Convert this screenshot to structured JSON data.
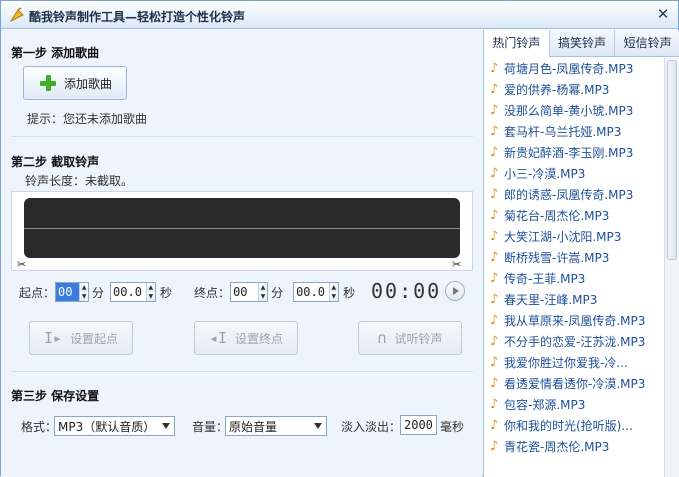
{
  "window": {
    "title": "酷我铃声制作工具—轻松打造个性化铃声",
    "close": "✕"
  },
  "step1": {
    "title": "第一步 添加歌曲",
    "add_button": "添加歌曲",
    "hint": "提示：您还未添加歌曲"
  },
  "step2": {
    "title": "第二步 截取铃声",
    "length_label": "铃声长度：未截取。",
    "start_label": "起点：",
    "end_label": "终点：",
    "min_unit": "分",
    "sec_unit": "秒",
    "start_min": "00",
    "start_sec": "00.0",
    "end_min": "00",
    "end_sec": "00.0",
    "time_display": "00:00",
    "set_start_button": "设置起点",
    "set_end_button": "设置终点",
    "preview_button": "试听铃声"
  },
  "step3": {
    "title": "第三步 保存设置",
    "format_label": "格式：",
    "format_value": "MP3（默认音质）",
    "volume_label": "音量：",
    "volume_value": "原始音量",
    "fade_label": "淡入淡出：",
    "fade_value": "2000",
    "fade_unit": "毫秒"
  },
  "tabs": [
    {
      "label": "热门铃声"
    },
    {
      "label": "搞笑铃声"
    },
    {
      "label": "短信铃声"
    }
  ],
  "ringtones": [
    "荷塘月色-凤凰传奇.MP3",
    "爱的供养-杨幂.MP3",
    "没那么简单-黄小琥.MP3",
    "套马杆-乌兰托娅.MP3",
    "新贵妃醉酒-李玉刚.MP3",
    "小三-冷漠.MP3",
    "郎的诱惑-凤凰传奇.MP3",
    "菊花台-周杰伦.MP3",
    "大笑江湖-小沈阳.MP3",
    "断桥残雪-许嵩.MP3",
    "传奇-王菲.MP3",
    "春天里-汪峰.MP3",
    "我从草原来-凤凰传奇.MP3",
    "不分手的恋爱-汪苏泷.MP3",
    "我爱你胜过你爱我-冷...",
    "看透爱情看透你-冷漠.MP3",
    "包容-郑源.MP3",
    "你和我的时光(抢听版)...",
    "青花瓷-周杰伦.MP3"
  ]
}
